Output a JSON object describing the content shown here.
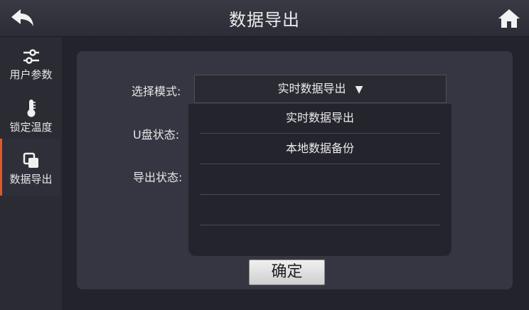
{
  "header": {
    "title": "数据导出"
  },
  "sidebar": {
    "items": [
      {
        "label": "用户参数",
        "icon": "sliders-icon"
      },
      {
        "label": "锁定温度",
        "icon": "thermometer-icon"
      },
      {
        "label": "数据导出",
        "icon": "copy-icon",
        "active": true
      }
    ]
  },
  "form": {
    "mode_label": "选择模式:",
    "mode_value": "实时数据导出",
    "usb_label": "U盘状态:",
    "export_label": "导出状态:"
  },
  "dropdown": {
    "options": [
      "实时数据导出",
      "本地数据备份",
      "",
      "",
      ""
    ]
  },
  "actions": {
    "confirm_label": "确定"
  },
  "colors": {
    "accent": "#e05a2a",
    "panel": "#363642",
    "background": "#23232c"
  }
}
